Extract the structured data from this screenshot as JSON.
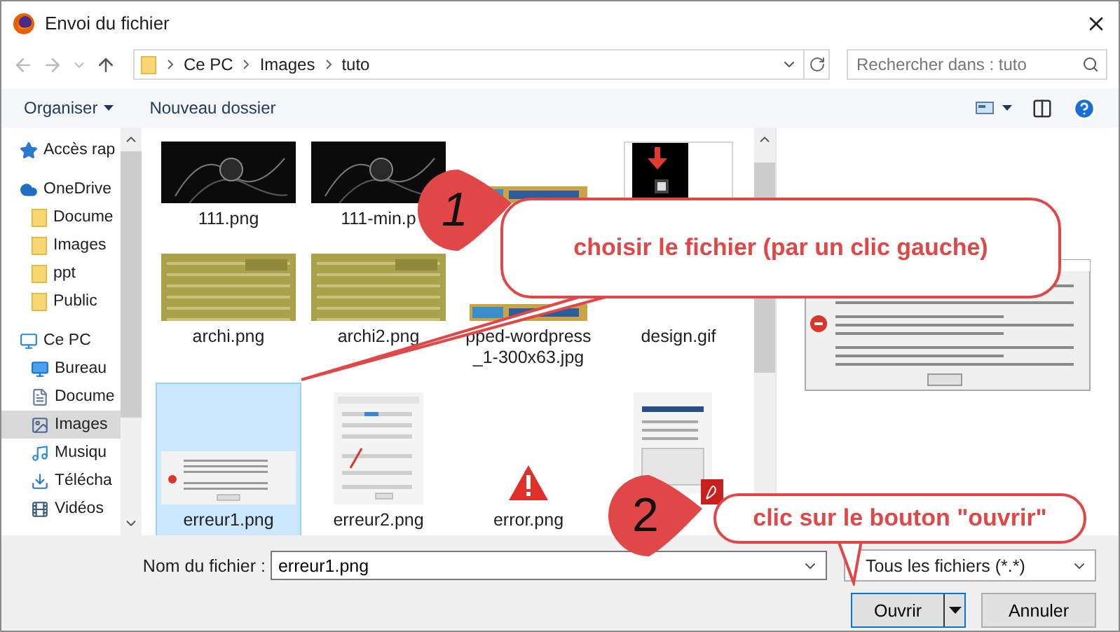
{
  "window": {
    "title": "Envoi du fichier"
  },
  "address": {
    "crumbs": [
      "Ce PC",
      "Images",
      "tuto"
    ]
  },
  "search": {
    "placeholder": "Rechercher dans : tuto"
  },
  "toolbar": {
    "organize": "Organiser",
    "new_folder": "Nouveau dossier"
  },
  "sidebar": {
    "items": [
      {
        "label": "Accès rap",
        "kind": "star",
        "selected": false
      },
      {
        "label": "OneDrive",
        "kind": "cloud",
        "selected": false,
        "children": [
          {
            "label": "Docume",
            "kind": "folder",
            "selected": false
          },
          {
            "label": "Images",
            "kind": "folder",
            "selected": false
          },
          {
            "label": "ppt",
            "kind": "folder",
            "selected": false
          },
          {
            "label": "Public",
            "kind": "folder",
            "selected": false
          }
        ]
      },
      {
        "label": "Ce PC",
        "kind": "pc",
        "selected": false,
        "children": [
          {
            "label": "Bureau",
            "kind": "desktop",
            "selected": false
          },
          {
            "label": "Docume",
            "kind": "document",
            "selected": false
          },
          {
            "label": "Images",
            "kind": "pictures",
            "selected": true
          },
          {
            "label": "Musiqu",
            "kind": "music",
            "selected": false
          },
          {
            "label": "Télécha",
            "kind": "download",
            "selected": false
          },
          {
            "label": "Vidéos",
            "kind": "video",
            "selected": false
          }
        ]
      }
    ]
  },
  "file_rows": [
    {
      "files": [
        {
          "name": "111.png",
          "kind": "dark",
          "selected": false
        },
        {
          "name": "111-min.p",
          "kind": "dark",
          "selected": false
        },
        {
          "kind": "banner",
          "selected": false
        },
        {
          "kind": "windows",
          "selected": false
        }
      ]
    },
    {
      "files": [
        {
          "name": "archi.png",
          "kind": "olive",
          "selected": false
        },
        {
          "name": "archi2.png",
          "kind": "olive",
          "selected": false
        },
        {
          "name": "pped-wordpress_1-300x63.jpg",
          "kind": "banner",
          "selected": false
        },
        {
          "name": "design.gif",
          "kind": "hidden",
          "selected": false
        }
      ]
    },
    {
      "files": [
        {
          "name": "erreur1.png",
          "kind": "dialog",
          "selected": true
        },
        {
          "name": "erreur2.png",
          "kind": "form",
          "selected": false
        },
        {
          "name": "error.png",
          "kind": "alert",
          "selected": false
        },
        {
          "kind": "pdf",
          "selected": false
        }
      ]
    }
  ],
  "filename": {
    "label": "Nom du fichier :",
    "value": "erreur1.png"
  },
  "filter": {
    "value": "Tous les fichiers (*.*)"
  },
  "buttons": {
    "open": "Ouvrir",
    "cancel": "Annuler"
  },
  "callouts": [
    {
      "number": "1",
      "text": "choisir le fichier (par un clic gauche)"
    },
    {
      "number": "2",
      "text": "clic sur le bouton \"ouvrir\""
    }
  ]
}
